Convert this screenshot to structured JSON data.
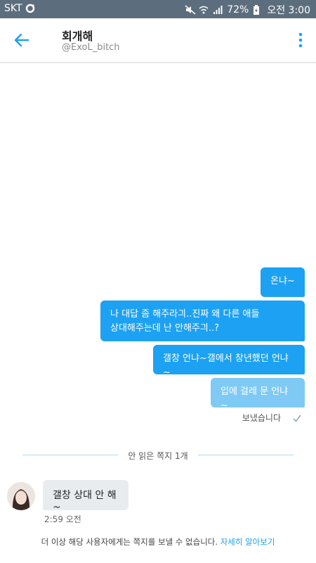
{
  "status_bar": {
    "carrier": "SKT",
    "battery": "72%",
    "time": "오전 3:00"
  },
  "header": {
    "title": "회개해",
    "handle": "@ExoL_bitch"
  },
  "messages_sent": [
    {
      "text": "온냐~"
    },
    {
      "line1": "나 대답 좀 해주라긔..진짜 왜 다른 애들",
      "line2": "상대해주는데 난 안해주긔..?"
    },
    {
      "text": "갤창 언냐~갤에서 창년했던 언냐~"
    },
    {
      "text": "입에 걸레 문 언냐~"
    }
  ],
  "sent_status": "보냈습니다",
  "unread_divider": "안 읽은 쪽지 1개",
  "received": {
    "text": "갤창 상대 안 해~",
    "time": "2:59 오전"
  },
  "footer": {
    "notice": "더 이상 해당 사용자에게는 쪽지를 보낼 수 없습니다.",
    "link": "자세히 알아보기"
  },
  "colors": {
    "accent": "#1da1f2",
    "pending_bubble": "#7fcaf5",
    "status_bar": "#5c6e7d",
    "received_bubble": "#e9ecef"
  }
}
